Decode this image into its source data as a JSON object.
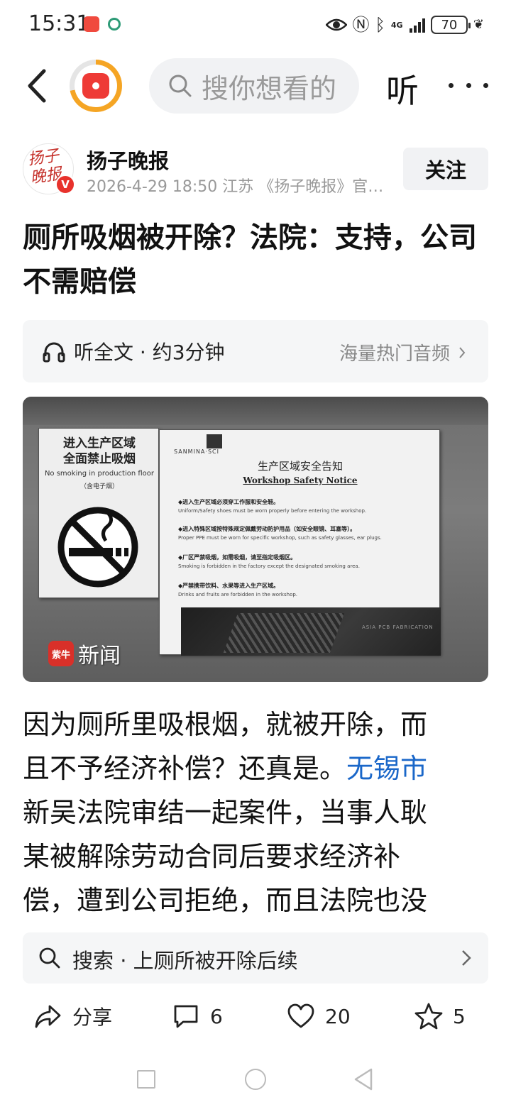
{
  "status_bar": {
    "time": "15:31",
    "battery": "70",
    "network": "4G"
  },
  "top_nav": {
    "search_placeholder": "搜你想看的",
    "listen_label": "听"
  },
  "author": {
    "name": "扬子晚报",
    "avatar_text": "扬子晚报",
    "verified_badge": "V",
    "meta": "2026-4-29  18:50  江苏  《扬子晚报》官…",
    "follow_label": "关注"
  },
  "article": {
    "title": "厕所吸烟被开除？法院：支持，公司不需赔偿",
    "audio_label": "听全文 · 约3分钟",
    "audio_more": "海量热门音频",
    "photo": {
      "left_sign_title_1": "进入生产区域",
      "left_sign_title_2": "全面禁止吸烟",
      "left_sign_en": "No smoking in production floor",
      "left_sign_sub": "（含电子烟）",
      "right_sign_logo": "SANMINA·SCI",
      "right_sign_title": "生产区域安全告知",
      "right_sign_title_en": "Workshop  Safety  Notice",
      "rules": [
        {
          "cn": "◆进入生产区域必须穿工作服和安全鞋。",
          "en": "Uniform/Safety shoes must be worn properly before entering the workshop."
        },
        {
          "cn": "◆进入特殊区域按特殊规定佩戴劳动防护用品（如安全眼镜、耳塞等）。",
          "en": "Proper PPE must be worn for specific workshop, such as safety glasses, ear plugs."
        },
        {
          "cn": "◆厂区严禁吸烟，如需吸烟，请至指定吸烟区。",
          "en": "Smoking is forbidden in the factory except the designated smoking area."
        },
        {
          "cn": "◆严禁携带饮料、水果等进入生产区域。",
          "en": "Drinks and fruits are forbidden in the workshop."
        }
      ],
      "bottom_text": "ASIA PCB FABRICATION",
      "watermark_logo": "紫牛",
      "watermark_text": "新闻"
    },
    "body": {
      "line1": "因为厕所里吸根烟，就被开除，而",
      "line2_pre": "且不予经济补偿？还真是。",
      "line2_link": "无锡市",
      "line3": "新吴法院审结一起案件，当事人耿",
      "line4": "某被解除劳动合同后要求经济补",
      "line5": "偿，遭到公司拒绝，而且法院也没"
    },
    "suggest": "搜索 · 上厕所被开除后续"
  },
  "actions": {
    "share_label": "分享",
    "comments_count": "6",
    "likes_count": "20",
    "favorites_count": "5"
  },
  "colors": {
    "link": "#1a67c9",
    "badge": "#e8322c",
    "accent_ring": "#f5a524"
  }
}
